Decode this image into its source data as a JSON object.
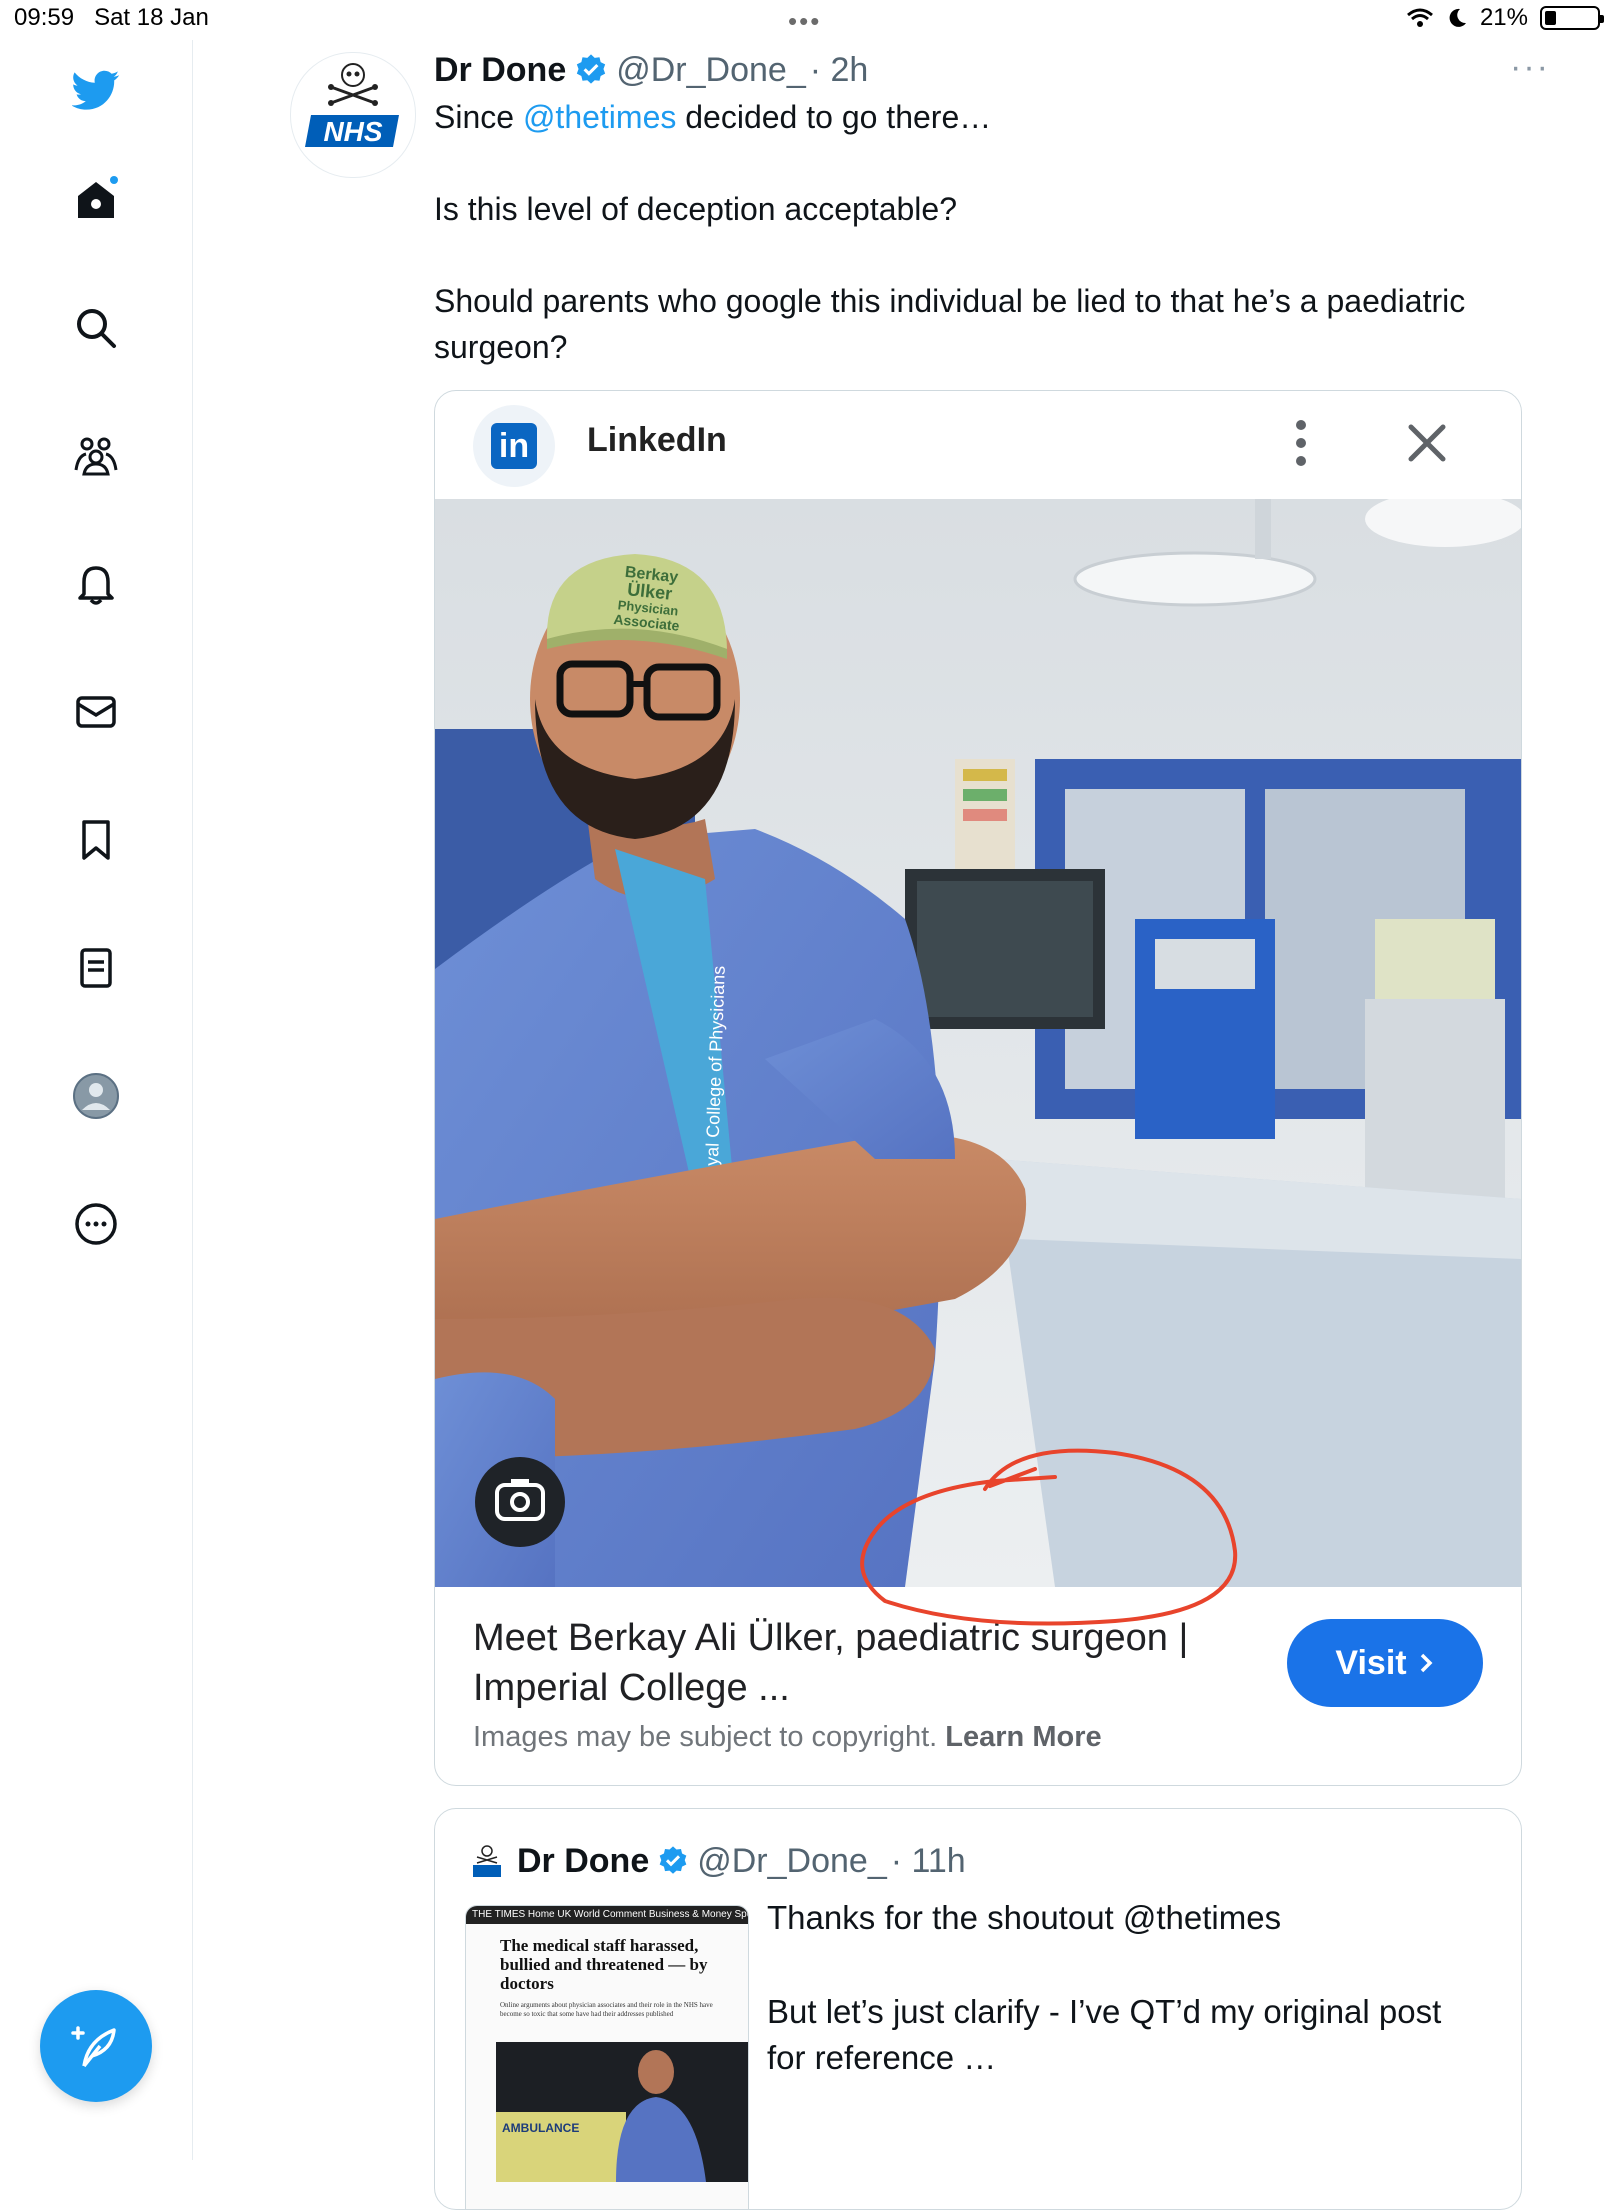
{
  "status_bar": {
    "time": "09:59",
    "date": "Sat 18 Jan",
    "battery": "21%",
    "battery_level": 0.21
  },
  "sidebar": {
    "items": [
      {
        "icon": "twitter-bird-icon"
      },
      {
        "icon": "home-icon"
      },
      {
        "icon": "search-icon"
      },
      {
        "icon": "communities-icon"
      },
      {
        "icon": "bell-icon"
      },
      {
        "icon": "mail-icon"
      },
      {
        "icon": "bookmark-icon"
      },
      {
        "icon": "lists-icon"
      },
      {
        "icon": "profile-icon"
      },
      {
        "icon": "more-circle-icon"
      }
    ],
    "compose_icon": "compose-feather-icon"
  },
  "tweet": {
    "author": "Dr Done",
    "handle": "@Dr_Done_",
    "time": "· 2h",
    "avatar_text": "NHS",
    "text_line1_a": "Since ",
    "text_line1_mention": "@thetimes",
    "text_line1_b": " decided to go there…",
    "text_para2": "Is this level of deception acceptable?",
    "text_para3": "Should parents who google this individual be lied to that he’s a paediatric surgeon?"
  },
  "card": {
    "source": "LinkedIn",
    "source_logo": "in",
    "photo": {
      "cap_text_line1": "Berkay",
      "cap_text_line2": "Ülker",
      "cap_text_line3": "Physician",
      "cap_text_line4": "Associate",
      "lanyard_text": "Royal College of Physicians"
    },
    "caption": "Meet Berkay Ali Ülker, paediatric surgeon | Imperial College ...",
    "copyright_text": "Images may be subject to copyright.",
    "learn_more": "Learn More",
    "visit_label": "Visit"
  },
  "quote": {
    "author": "Dr Done",
    "handle": "@Dr_Done_",
    "time": "· 11h",
    "text_para1": "Thanks for the shoutout @thetimes",
    "text_para2": "But let’s just clarify - I’ve QT’d my original post for reference …",
    "thumb": {
      "masthead": "THE TIMES   Home   UK   World   Comment   Business & Money   Sport   Life &",
      "headline": "The medical staff harassed, bullied and threatened — by doctors",
      "subhead": "Online arguments about physician associates and their role in the NHS have become so toxic that some have had their addresses published",
      "vehicle_text": "AMBULANCE"
    }
  }
}
